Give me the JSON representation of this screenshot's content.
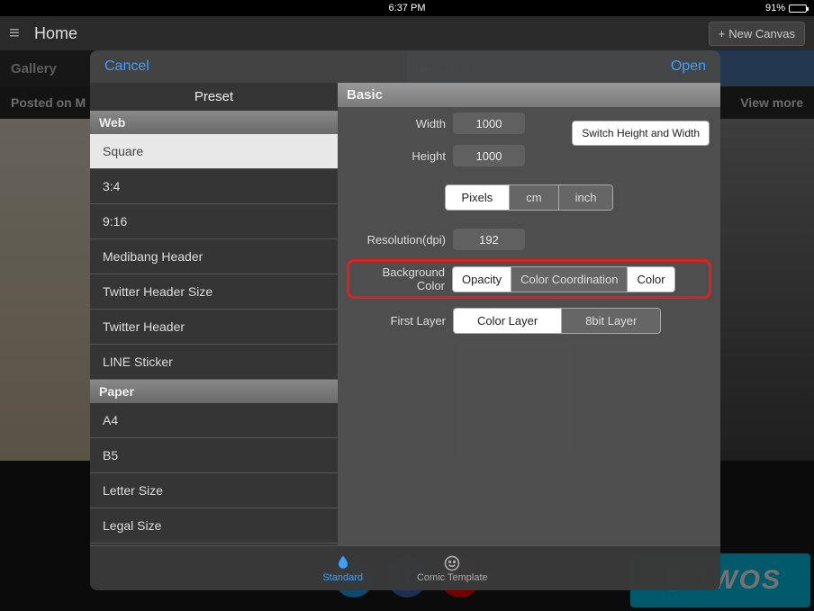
{
  "statusbar": {
    "time": "6:37 PM",
    "battery": "91%"
  },
  "header": {
    "title": "Home",
    "newcanvas": "New Canvas"
  },
  "gallery": {
    "tab_gallery": "Gallery",
    "tab_online": "Online",
    "posted": "Posted on M",
    "viewmore": "View more"
  },
  "twos": {
    "text": "TWOS"
  },
  "modal": {
    "cancel": "Cancel",
    "open": "Open",
    "preset_header": "Preset",
    "sections": {
      "web": "Web",
      "paper": "Paper"
    },
    "web_items": [
      "Square",
      "3:4",
      "9:16",
      "Medibang Header",
      "Twitter Header Size",
      "Twitter Header",
      "LINE Sticker"
    ],
    "paper_items": [
      "A4",
      "B5",
      "Letter Size",
      "Legal Size"
    ],
    "selected_item": "Square",
    "basic_header": "Basic",
    "labels": {
      "width": "Width",
      "height": "Height",
      "resolution": "Resolution(dpi)",
      "bgcolor": "Background Color",
      "firstlayer": "First Layer"
    },
    "values": {
      "width": "1000",
      "height": "1000",
      "resolution": "192"
    },
    "switch_btn": "Switch Height and Width",
    "units": {
      "pixels": "Pixels",
      "cm": "cm",
      "inch": "inch"
    },
    "bg_opts": {
      "opacity": "Opacity",
      "coord": "Color Coordination",
      "color": "Color"
    },
    "layer_opts": {
      "color": "Color Layer",
      "eight": "8bit Layer"
    },
    "footer": {
      "standard": "Standard",
      "comic": "Comic Template"
    }
  }
}
